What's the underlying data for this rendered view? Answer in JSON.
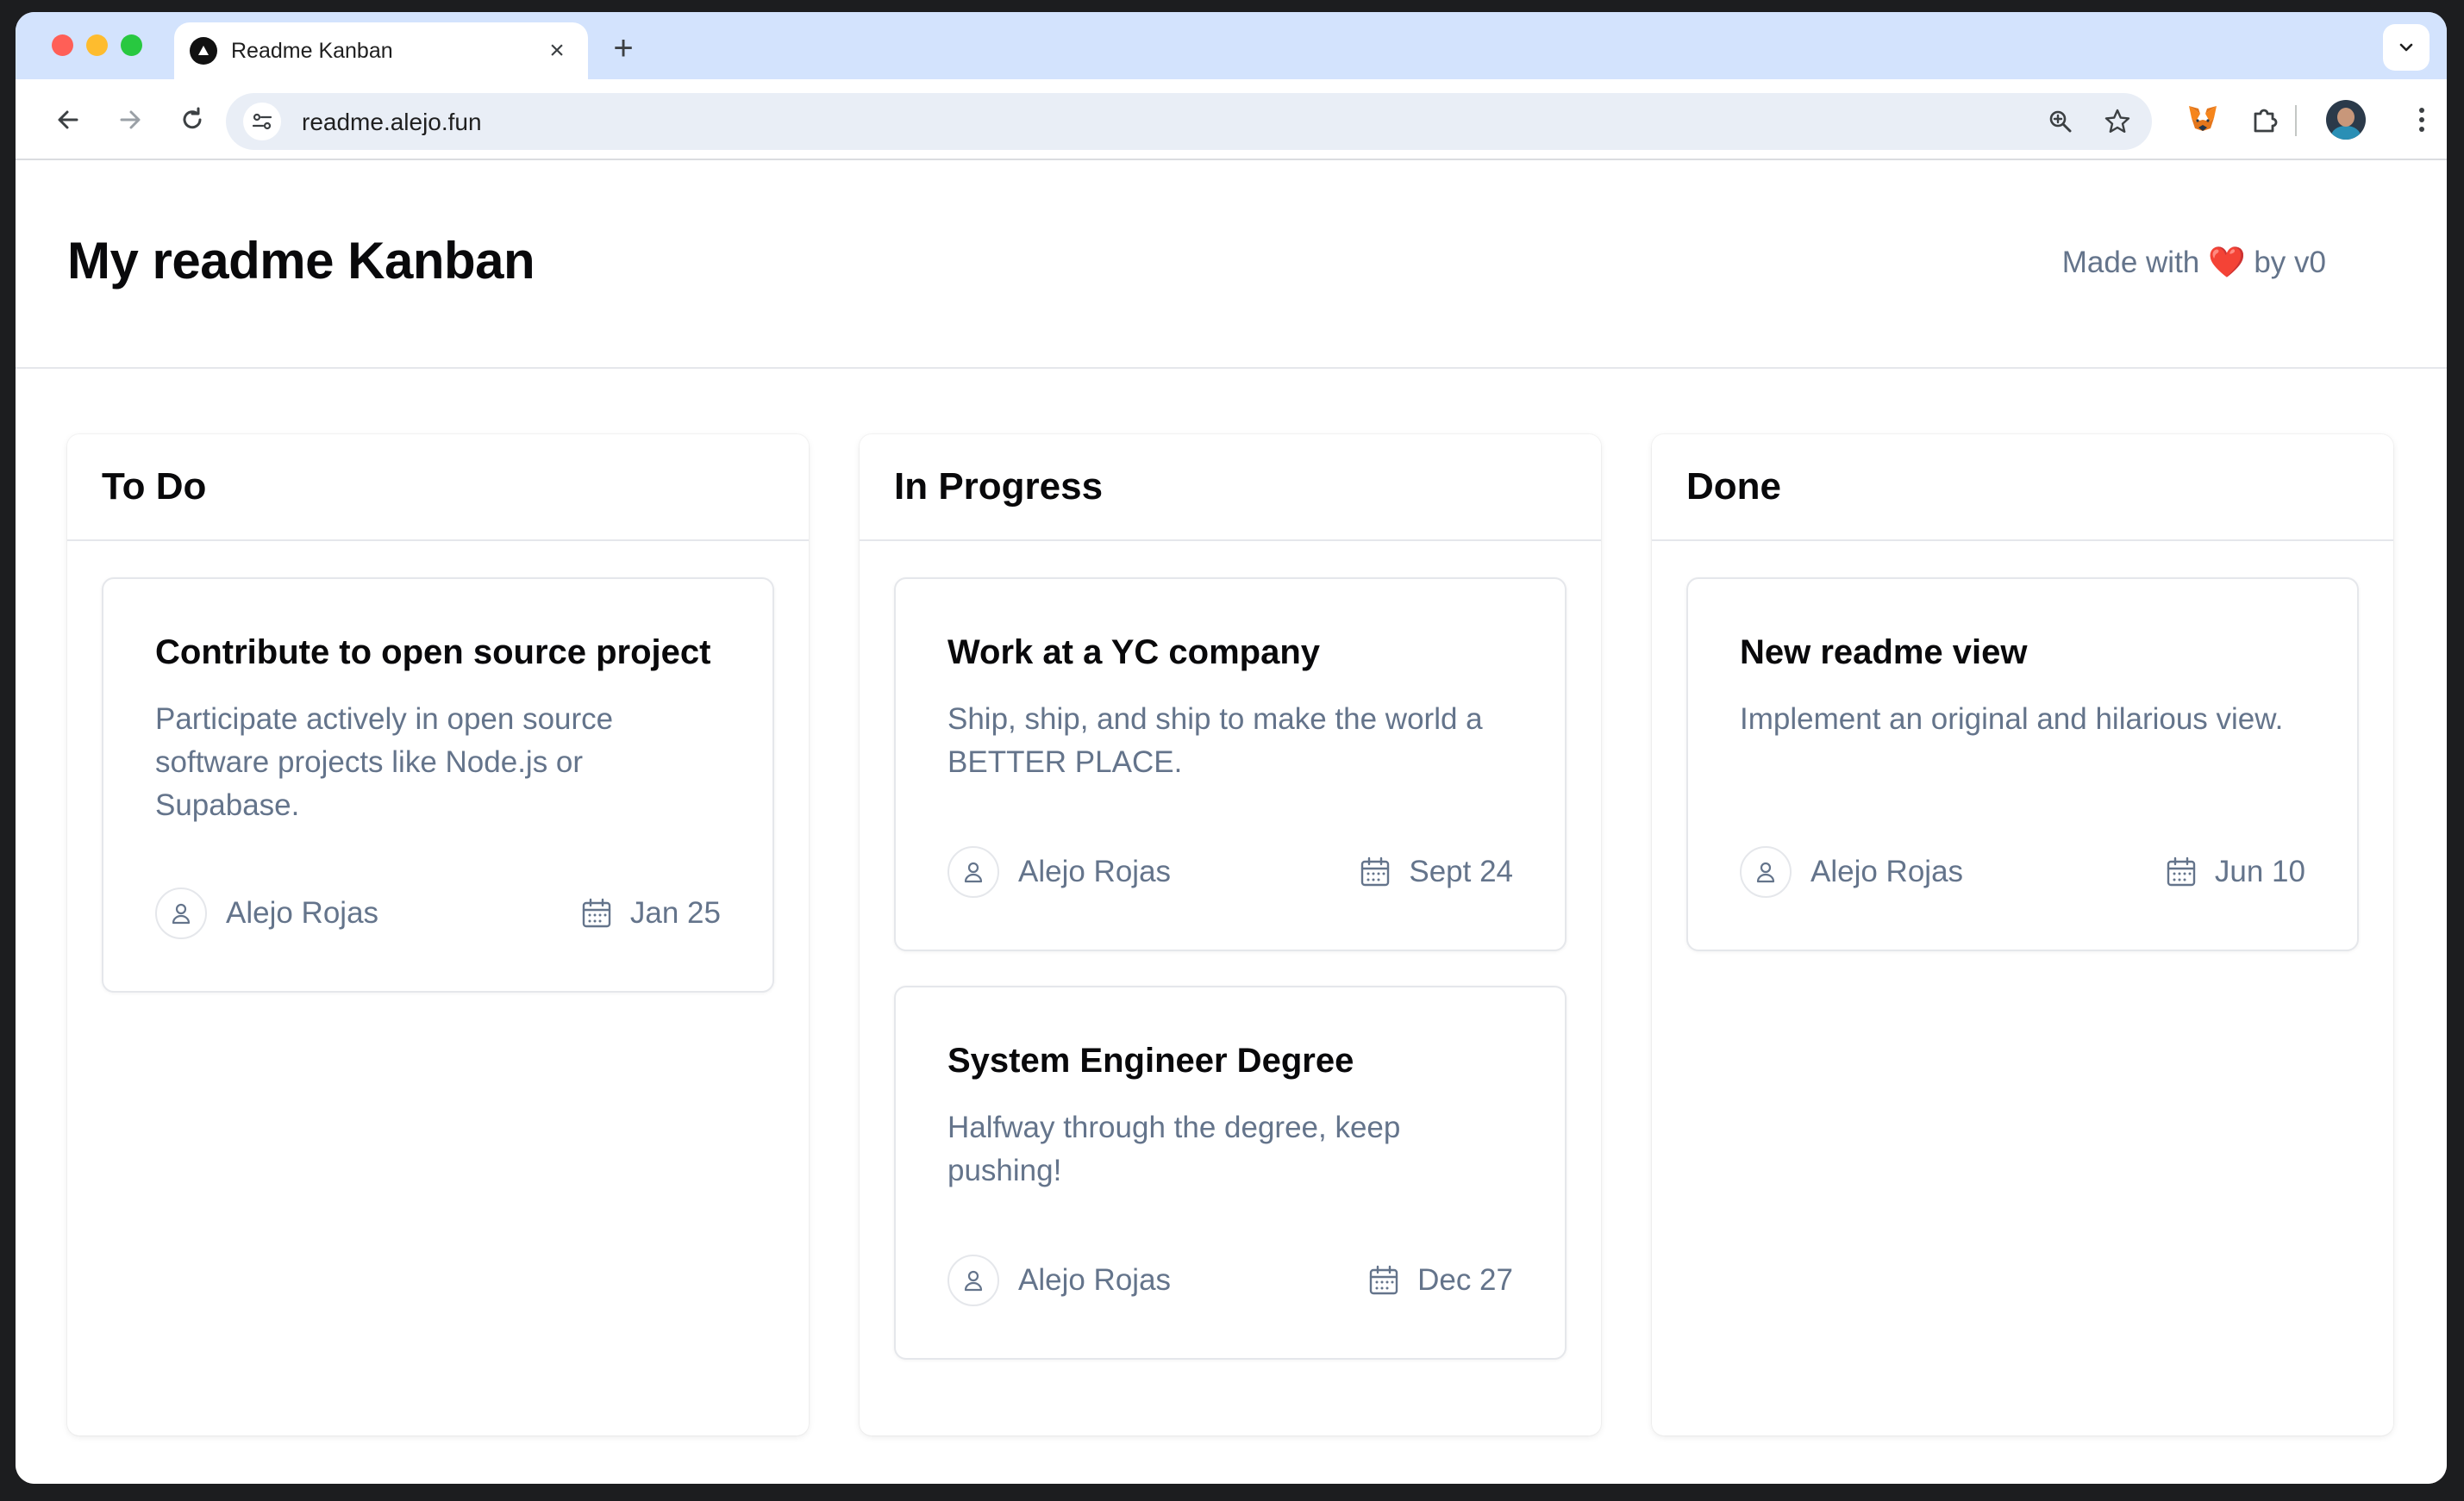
{
  "browser": {
    "tab_title": "Readme Kanban",
    "tab_close": "×",
    "new_tab": "+",
    "url": "readme.alejo.fun"
  },
  "page": {
    "title": "My readme Kanban",
    "made_with_prefix": "Made with",
    "made_with_heart": "❤️",
    "made_with_suffix": "by v0"
  },
  "columns": [
    {
      "title": "To Do",
      "cards": [
        {
          "title": "Contribute to open source project",
          "description": "Participate actively in open source software projects like Node.js or Supabase.",
          "assignee": "Alejo Rojas",
          "date": "Jan 25"
        }
      ]
    },
    {
      "title": "In Progress",
      "cards": [
        {
          "title": "Work at a YC company",
          "description": "Ship, ship, and ship to make the world a BETTER PLACE.",
          "assignee": "Alejo Rojas",
          "date": "Sept 24"
        },
        {
          "title": "System Engineer Degree",
          "description": "Halfway through the degree, keep pushing!",
          "assignee": "Alejo Rojas",
          "date": "Dec 27"
        }
      ]
    },
    {
      "title": "Done",
      "cards": [
        {
          "title": "New readme view",
          "description": "Implement an original and hilarious view.",
          "assignee": "Alejo Rojas",
          "date": "Jun 10"
        }
      ]
    }
  ]
}
